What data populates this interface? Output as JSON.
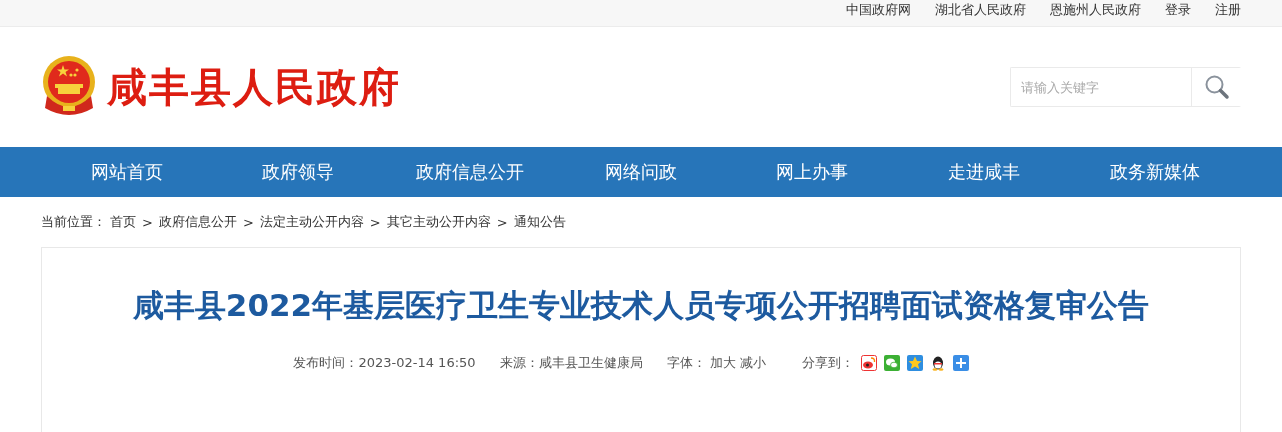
{
  "top_links": [
    "中国政府网",
    "湖北省人民政府",
    "恩施州人民政府",
    "登录",
    "注册"
  ],
  "site_title": "咸丰县人民政府",
  "search": {
    "placeholder": "请输入关键字"
  },
  "nav": [
    "网站首页",
    "政府领导",
    "政府信息公开",
    "网络问政",
    "网上办事",
    "走进咸丰",
    "政务新媒体"
  ],
  "breadcrumb": {
    "label": "当前位置：",
    "items": [
      "首页",
      "政府信息公开",
      "法定主动公开内容",
      "其它主动公开内容",
      "通知公告"
    ],
    "separator": ">"
  },
  "article": {
    "title": "咸丰县2022年基层医疗卫生专业技术人员专项公开招聘面试资格复审公告",
    "publish": {
      "label": "发布时间：",
      "value": "2023-02-14 16:50"
    },
    "source": {
      "label": "来源：",
      "value": "咸丰县卫生健康局"
    },
    "font_size": {
      "label": "字体：",
      "actions": [
        "加大",
        "减小"
      ]
    },
    "share": {
      "label": "分享到：",
      "targets": [
        {
          "kind": "weibo"
        },
        {
          "kind": "wechat"
        },
        {
          "kind": "qzone"
        },
        {
          "kind": "qq"
        },
        {
          "kind": "more"
        }
      ]
    }
  }
}
